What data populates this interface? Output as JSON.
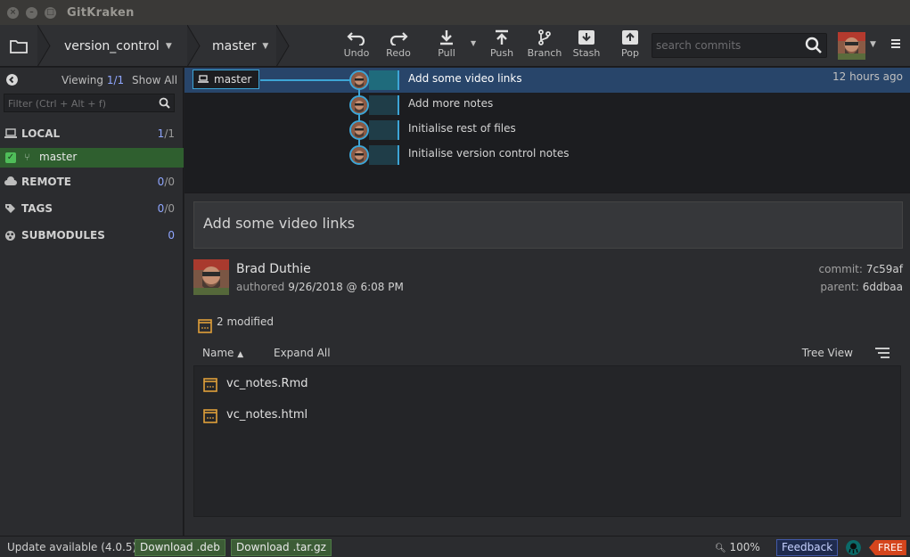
{
  "window": {
    "title": "GitKraken"
  },
  "toolbar": {
    "repo": "version_control",
    "branch": "master",
    "actions": [
      "Undo",
      "Redo",
      "Pull",
      "Push",
      "Branch",
      "Stash",
      "Pop"
    ],
    "search_placeholder": "search commits"
  },
  "sidebar": {
    "viewing_label": "Viewing",
    "viewing_count": "1",
    "viewing_total": "/1",
    "show_all": "Show All",
    "filter_placeholder": "Filter (Ctrl + Alt + f)",
    "sections": [
      {
        "title": "LOCAL",
        "count": "1",
        "total": "/1"
      },
      {
        "title": "REMOTE",
        "count": "0",
        "total": "/0"
      },
      {
        "title": "TAGS",
        "count": "0",
        "total": "/0"
      },
      {
        "title": "SUBMODULES",
        "count": "0",
        "total": ""
      }
    ],
    "local_branch": "master"
  },
  "graph": {
    "branch_label": "master",
    "commits": [
      {
        "message": "Add some video links",
        "time": "12 hours ago",
        "selected": true
      },
      {
        "message": "Add more notes",
        "time": ""
      },
      {
        "message": "Initialise rest of files",
        "time": ""
      },
      {
        "message": "Initialise version control notes",
        "time": ""
      }
    ]
  },
  "detail": {
    "summary": "Add some video links",
    "author": "Brad Duthie",
    "authored_label": "authored",
    "authored_date": "9/26/2018 @ 6:08 PM",
    "commit_label": "commit:",
    "commit_hash": "7c59af",
    "parent_label": "parent:",
    "parent_hash": "6ddbaa",
    "modified": "2 modified",
    "name_header": "Name",
    "expand_all": "Expand All",
    "tree_view": "Tree View",
    "files": [
      "vc_notes.Rmd",
      "vc_notes.html"
    ]
  },
  "statusbar": {
    "update": "Update available (4.0.5)",
    "download_deb": "Download .deb",
    "download_tar": "Download .tar.gz",
    "zoom": "100%",
    "feedback": "Feedback",
    "plan": "FREE"
  },
  "colors": {
    "accent": "#3da5d6",
    "selected_row": "#28456a",
    "local_branch_bg": "#2f5f2f",
    "free_badge": "#d5451d"
  }
}
